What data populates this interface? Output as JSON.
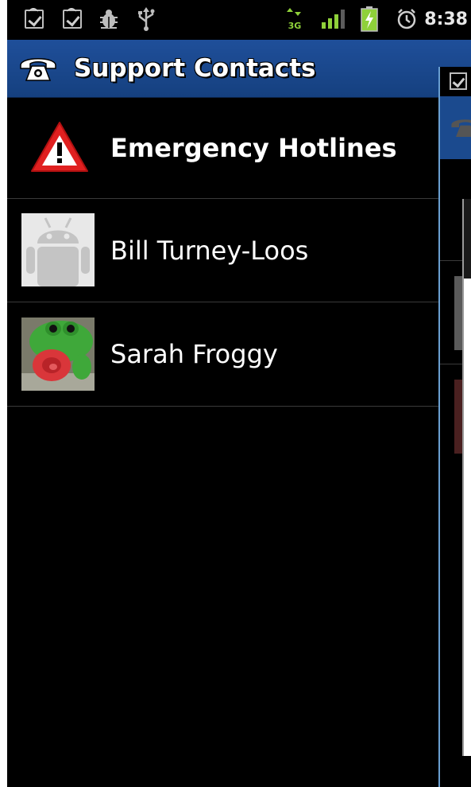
{
  "status_bar": {
    "time": "8:38",
    "network": "3G",
    "icons": [
      "checkbox-icon",
      "checkbox-icon",
      "bug-icon",
      "usb-icon",
      "network-3g-icon",
      "signal-icon",
      "battery-charging-icon",
      "alarm-icon"
    ]
  },
  "titlebar": {
    "title": "Support Contacts",
    "icon": "phone-icon"
  },
  "list": {
    "items": [
      {
        "label": "Emergency Hotlines",
        "icon": "warning-icon"
      },
      {
        "label": "Bill Turney-Loos",
        "icon": "android-avatar-icon"
      },
      {
        "label": "Sarah Froggy",
        "icon": "frog-photo"
      }
    ]
  },
  "colors": {
    "titlebar": "#1b4a8e",
    "background": "#000000",
    "divider": "#3a3a3a",
    "overlay_border": "#6a9fd1"
  }
}
